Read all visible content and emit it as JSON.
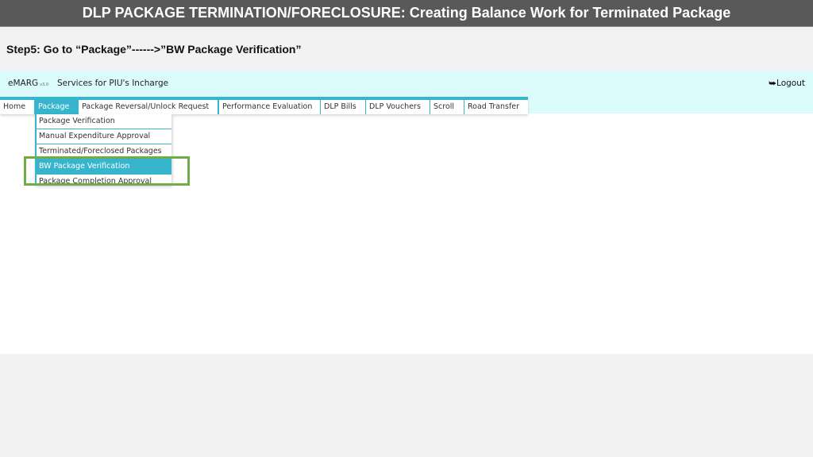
{
  "slide": {
    "title": "DLP PACKAGE TERMINATION/FORECLOSURE: Creating Balance Work for Terminated Package",
    "step": "Step5: Go to “Package”------>”BW Package Verification”"
  },
  "app": {
    "brand": "eMARG",
    "version": "v3.0",
    "service_title": "Services for PIU's Incharge",
    "logout_icon": "logout-icon",
    "logout_label": "Logout"
  },
  "nav": {
    "items": [
      {
        "label": "Home"
      },
      {
        "label": "Package",
        "active": true
      },
      {
        "label": "Package Reversal/Unlock Request"
      },
      {
        "label": "Performance Evaluation"
      },
      {
        "label": "DLP Bills"
      },
      {
        "label": "DLP Vouchers"
      },
      {
        "label": "Scroll"
      },
      {
        "label": "Road Transfer"
      }
    ]
  },
  "dropdown": {
    "items": [
      {
        "label": "Package Verification"
      },
      {
        "label": "Manual Expenditure Approval"
      },
      {
        "label": "Terminated/Foreclosed Packages"
      },
      {
        "label": "BW Package Verification",
        "selected": true
      },
      {
        "label": "Package Completion Approval"
      }
    ]
  },
  "colors": {
    "title_bar": "#595959",
    "header_bg": "#dcfbfd",
    "nav_accent": "#36b5cc",
    "highlight_box": "#70ad47"
  }
}
